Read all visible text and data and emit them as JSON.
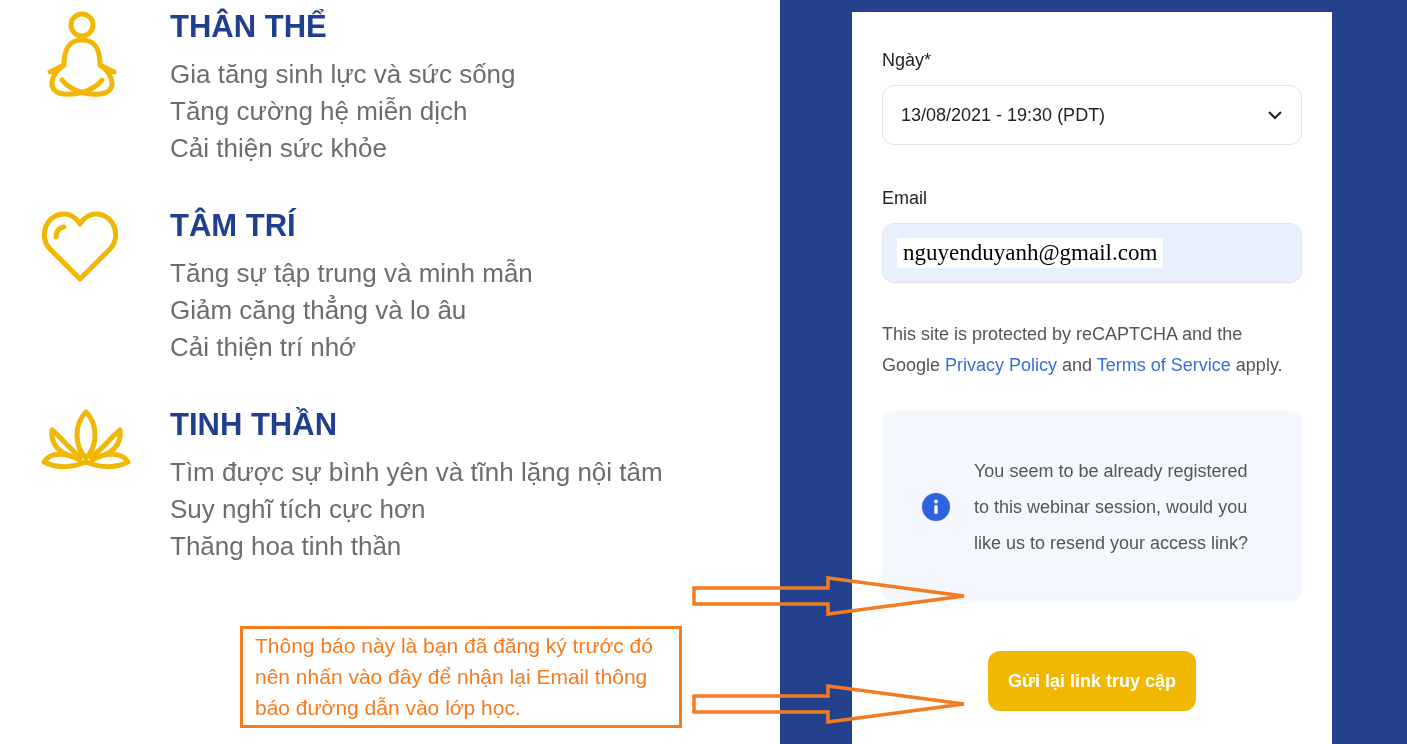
{
  "benefits": [
    {
      "title": "THÂN THỂ",
      "lines": [
        "Gia tăng sinh lực và sức sống",
        "Tăng cường hệ miễn dịch",
        "Cải thiện sức khỏe"
      ]
    },
    {
      "title": "TÂM TRÍ",
      "lines": [
        "Tăng sự tập trung và minh mẫn",
        "Giảm căng thẳng và lo âu",
        "Cải thiện trí nhớ"
      ]
    },
    {
      "title": "TINH THẦN",
      "lines": [
        "Tìm được sự bình yên và tĩnh lặng nội tâm",
        "Suy nghĩ tích cực hơn",
        "Thăng hoa tinh thần"
      ]
    }
  ],
  "form": {
    "date_label": "Ngày*",
    "date_value": "13/08/2021 - 19:30 (PDT)",
    "email_label": "Email",
    "email_value": "nguyenduyanh@gmail.com",
    "recaptcha_text": [
      "This site is protected by reCAPTCHA and the Google ",
      "Privacy Policy",
      " and ",
      "Terms of Service",
      " apply."
    ],
    "notice": "You seem to be already registered to this webinar session, would you like us to resend your access link?",
    "resend_button": "Gửi lại link truy cập"
  },
  "annotation": {
    "text": "Thông báo này là bạn đã đăng ký trước đó nên nhấn vào đây để nhận lại Email thông báo đường dẫn vào lớp học."
  }
}
